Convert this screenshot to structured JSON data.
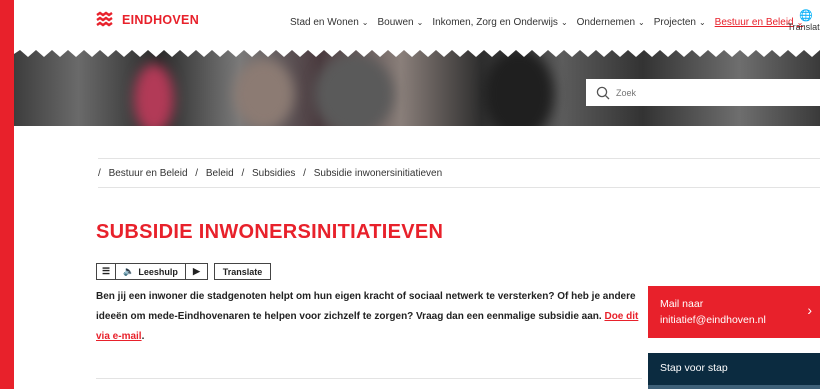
{
  "brand": {
    "name": "EINDHOVEN",
    "accent": "#e8212b",
    "dark": "#0b2b40"
  },
  "nav": {
    "items": [
      {
        "label": "Stad en Wonen",
        "active": false
      },
      {
        "label": "Bouwen",
        "active": false
      },
      {
        "label": "Inkomen, Zorg en Onderwijs",
        "active": false
      },
      {
        "label": "Ondernemen",
        "active": false
      },
      {
        "label": "Projecten",
        "active": false
      },
      {
        "label": "Bestuur en Beleid",
        "active": true
      }
    ],
    "translate_label": "Translate"
  },
  "search": {
    "placeholder": "Zoek"
  },
  "breadcrumb": [
    "Bestuur en Beleid",
    "Beleid",
    "Subsidies",
    "Subsidie inwonersinitiatieven"
  ],
  "page_title": "SUBSIDIE INWONERSINITIATIEVEN",
  "reader": {
    "leeshulp_label": "Leeshulp",
    "translate_label": "Translate"
  },
  "intro": {
    "text": "Ben jij een inwoner die stadgenoten helpt om hun eigen kracht of sociaal netwerk te versterken? Of heb je andere ideeën om mede-Eindhovenaren te helpen voor zichzelf te zorgen? Vraag dan een eenmalige subsidie aan. ",
    "link": "Doe dit via e-mail",
    "end": "."
  },
  "sidebar": {
    "mail_line1": "Mail naar",
    "mail_line2": "initiatief@eindhoven.nl",
    "step_title": "Stap voor stap"
  }
}
